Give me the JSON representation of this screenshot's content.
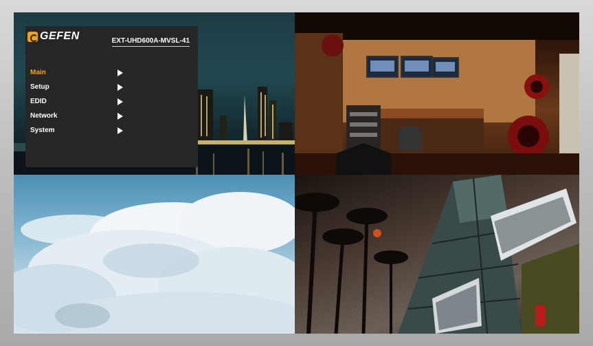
{
  "osd": {
    "brand": "GEFEN",
    "model": "EXT-UHD600A-MVSL-41",
    "menu": [
      {
        "label": "Main",
        "active": true
      },
      {
        "label": "Setup",
        "active": false
      },
      {
        "label": "EDID",
        "active": false
      },
      {
        "label": "Network",
        "active": false
      },
      {
        "label": "System",
        "active": false
      }
    ]
  },
  "colors": {
    "accent": "#f3a11b",
    "osd_background": "#262626",
    "bezel": "#bdbdbd"
  },
  "icons": {
    "logo": "gefen-logo-icon",
    "submenu": "arrow-right-icon"
  }
}
